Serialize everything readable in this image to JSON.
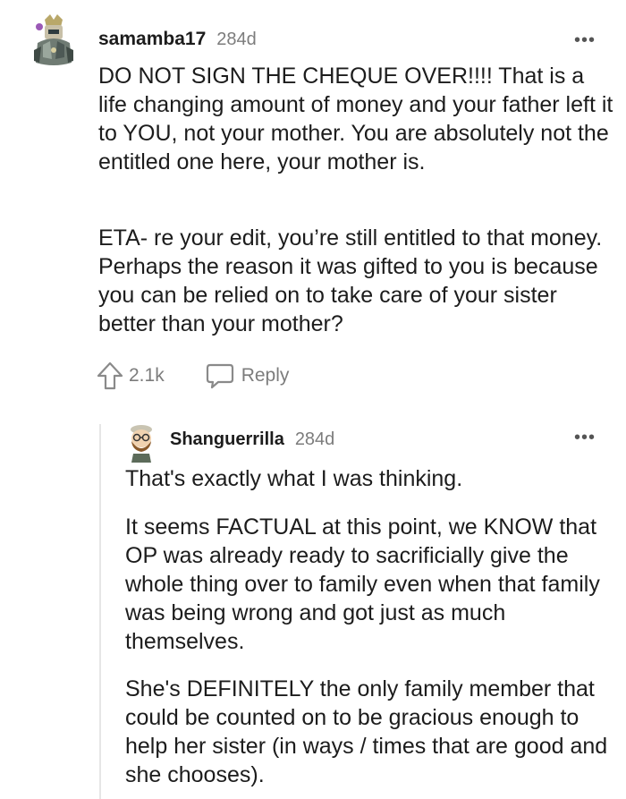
{
  "top_comment": {
    "username": "samamba17",
    "age": "284d",
    "more_label": "•••",
    "paragraphs": [
      "DO NOT SIGN THE CHEQUE OVER!!!! That is a life changing amount of money and your father left it to YOU, not your mother. You are absolutely not the entitled one here, your mother is.",
      "ETA- re your edit, you’re still entitled to that money. Perhaps the reason it was gifted to you is because you can be relied on to take care of your sister better than your mother?"
    ],
    "upvotes": "2.1k",
    "reply_label": "Reply",
    "icons": {
      "avatar": "avatar-icon",
      "upvote": "upvote-arrow-icon",
      "reply": "speech-bubble-icon"
    }
  },
  "reply_comment": {
    "username": "Shanguerrilla",
    "age": "284d",
    "more_label": "•••",
    "paragraphs": [
      "That's exactly what I was thinking.",
      "It seems FACTUAL at this point, we KNOW that OP was already ready to sacrificially give the whole thing over to family even when that family was being wrong and got just as much themselves.",
      "She's DEFINITELY the only family member that could be counted on to be gracious enough to help her sister (in ways / times that are good and she chooses)."
    ]
  },
  "colors": {
    "text": "#1c1c1c",
    "meta": "#7c7c7c",
    "thread_line": "#e6e6e6"
  }
}
